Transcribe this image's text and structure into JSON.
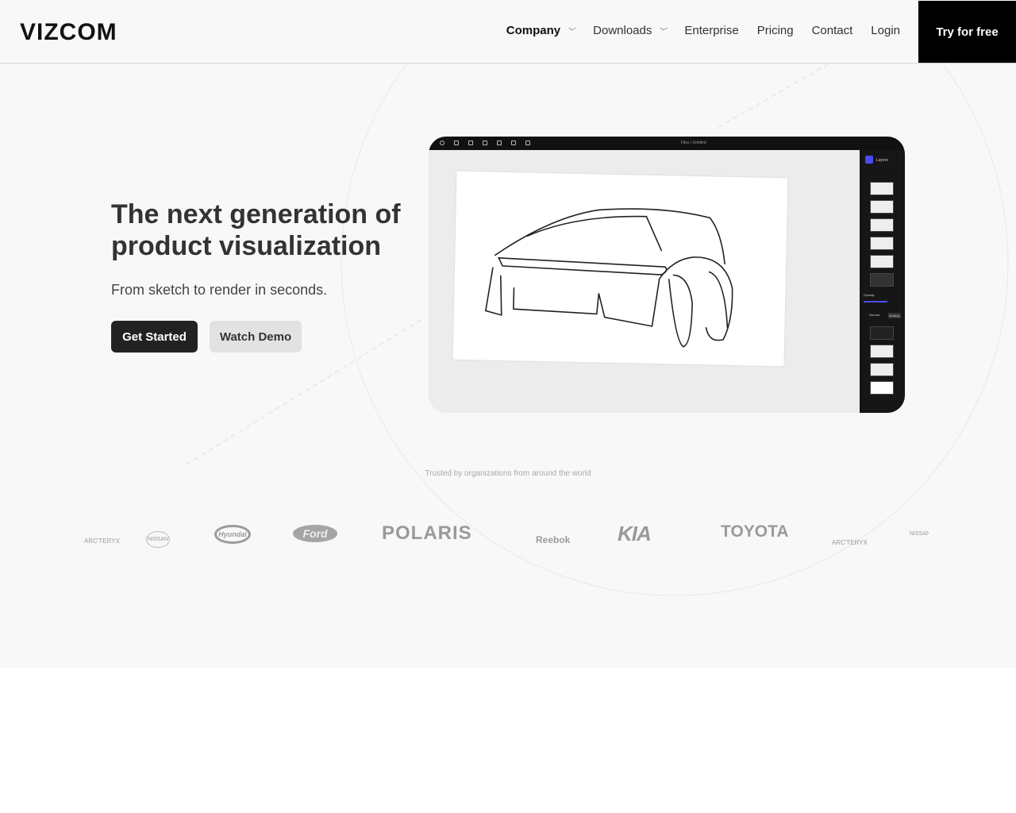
{
  "header": {
    "logo": "VIZCOM",
    "nav": [
      {
        "label": "Company",
        "dropdown": true
      },
      {
        "label": "Downloads",
        "dropdown": true
      },
      {
        "label": "Enterprise"
      },
      {
        "label": "Pricing"
      },
      {
        "label": "Contact"
      },
      {
        "label": "Login"
      }
    ],
    "cta": "Try for free"
  },
  "hero": {
    "title": "The next generation of product visualization",
    "subtitle": "From sketch to render in seconds.",
    "primary": "Get Started",
    "secondary": "Watch Demo"
  },
  "app": {
    "file_label": "Files / Untitled",
    "panel_title": "Layers",
    "opacity_label": "Opacity",
    "opacity": 0.7,
    "blend_modes": [
      "Normal",
      "Multiply"
    ],
    "accent": "#4b4bf0"
  },
  "trusted": "Trusted by organizations from around the world",
  "logos": [
    "ARC'TERYX",
    "NISSAN",
    "Hyundai",
    "Ford",
    "POLARIS",
    "Reebok",
    "KIA",
    "TOYOTA",
    "ARC'TERYX",
    "NISSAN"
  ]
}
